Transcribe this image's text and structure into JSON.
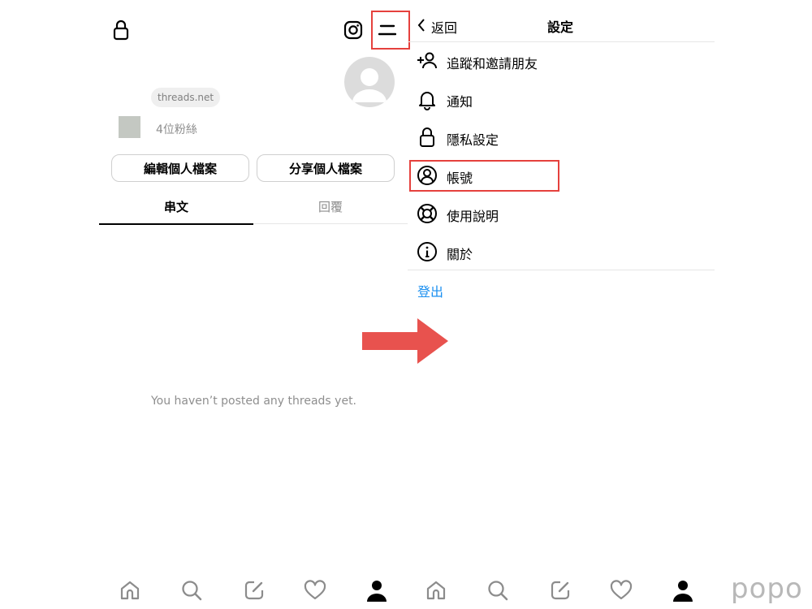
{
  "profile": {
    "username_domain": "threads.net",
    "followers": "4位粉絲",
    "edit_button": "編輯個人檔案",
    "share_button": "分享個人檔案",
    "tabs": [
      "串文",
      "回覆"
    ],
    "empty_message": "You haven’t posted any threads yet."
  },
  "settings": {
    "back_label": "返回",
    "title": "設定",
    "items": [
      {
        "label": "追蹤和邀請朋友",
        "icon": "add-person-icon"
      },
      {
        "label": "通知",
        "icon": "bell-icon"
      },
      {
        "label": "隱私設定",
        "icon": "lock-icon"
      },
      {
        "label": "帳號",
        "icon": "account-circle-icon"
      },
      {
        "label": "使用說明",
        "icon": "lifebuoy-icon"
      },
      {
        "label": "關於",
        "icon": "info-icon"
      }
    ],
    "logout": "登出"
  },
  "watermark": "popo",
  "colors": {
    "highlight": "#e5413d",
    "arrow": "#e8524e",
    "logout_link": "#1a8ff0",
    "inactive_tab": "#8e8e8e"
  }
}
